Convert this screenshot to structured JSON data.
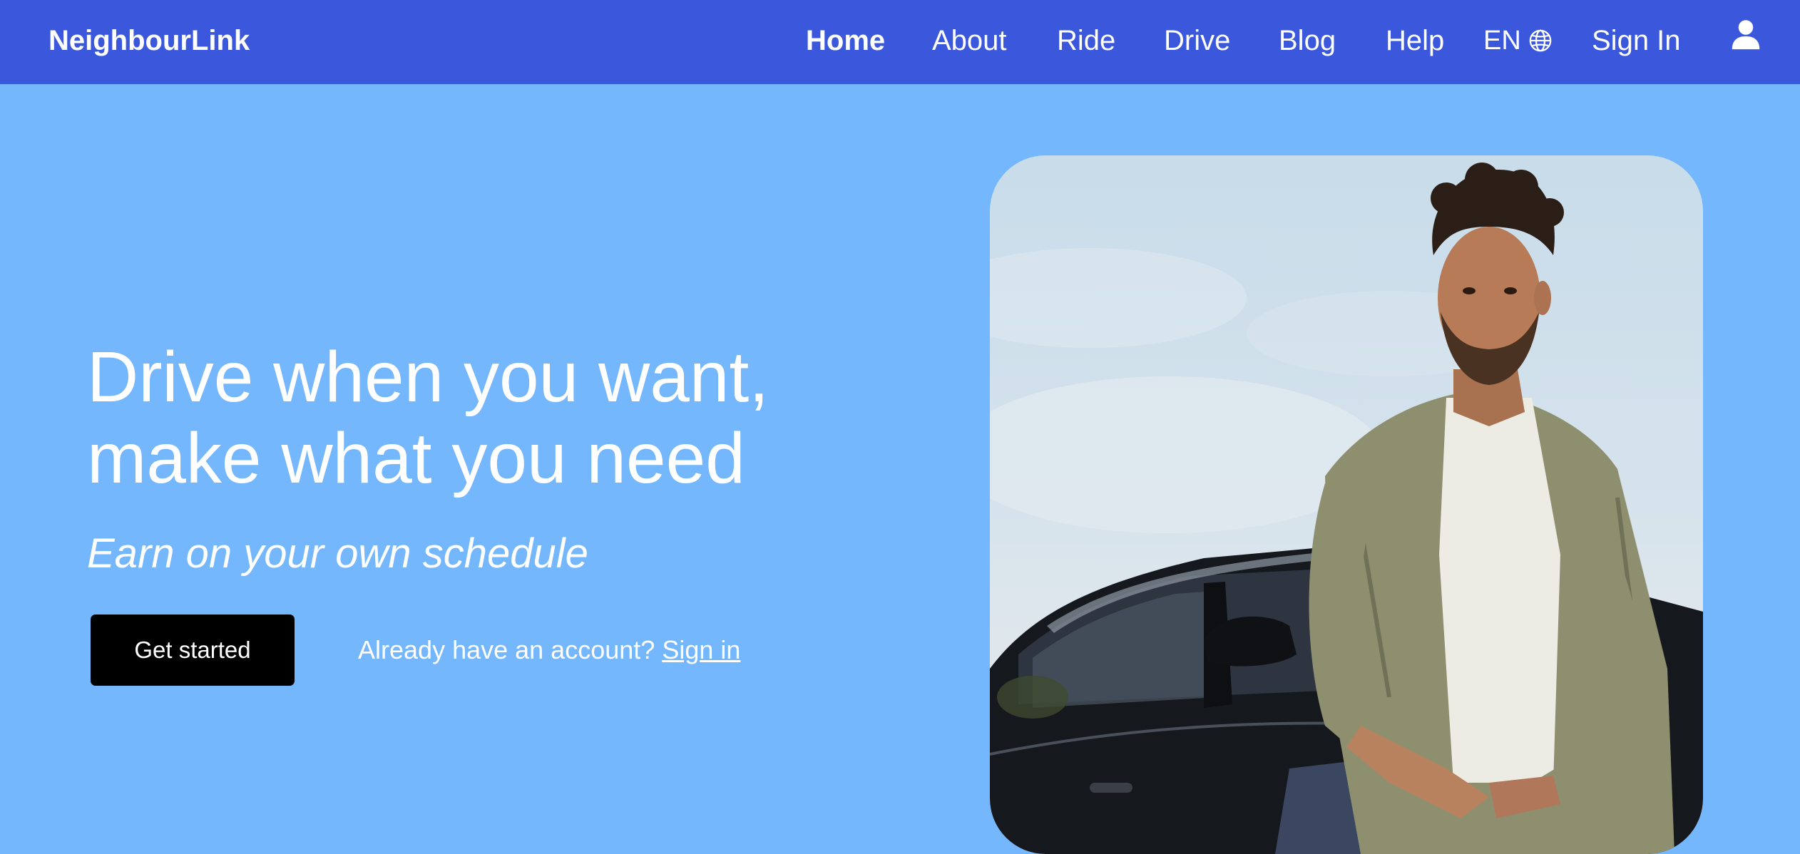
{
  "brand": {
    "name": "NeighbourLink"
  },
  "nav": {
    "items": [
      "Home",
      "About",
      "Ride",
      "Drive",
      "Blog",
      "Help"
    ],
    "active": "Home",
    "language": "EN",
    "sign_in": "Sign In"
  },
  "hero": {
    "title_line1": "Drive when you want,",
    "title_line2": "make what you need",
    "subtitle": "Earn on your own schedule",
    "cta_label": "Get started",
    "account_prompt": "Already have an account?",
    "sign_in_link": "Sign in"
  },
  "colors": {
    "navbar": "#3b58dd",
    "page_background": "#74b7fd",
    "cta_background": "#000000",
    "text": "#ffffff"
  },
  "icons": {
    "language": "globe-icon",
    "account": "user-icon"
  }
}
